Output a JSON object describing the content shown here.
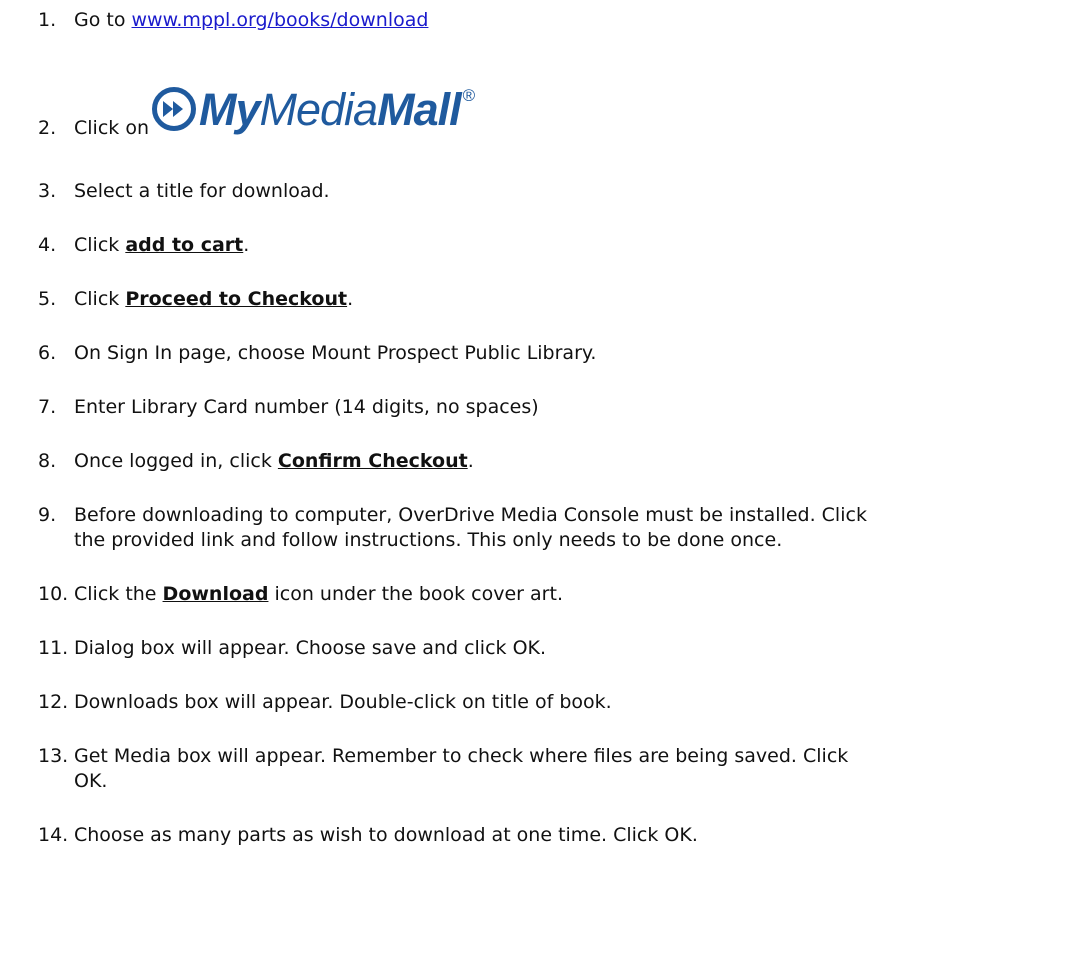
{
  "steps": [
    {
      "num": "1.",
      "pre": "Go to ",
      "link": "www.mppl.org/books/download"
    },
    {
      "num": "2.",
      "text": "Click on"
    },
    {
      "num": "3.",
      "text": "Select a title for download."
    },
    {
      "num": "4.",
      "pre": "Click ",
      "bold": "add to cart",
      "post": "."
    },
    {
      "num": "5.",
      "pre": "Click ",
      "bold": "Proceed to Checkout",
      "post": "."
    },
    {
      "num": "6.",
      "text": "On Sign In page, choose Mount Prospect Public Library."
    },
    {
      "num": "7.",
      "text": "Enter Library Card number (14 digits, no spaces)"
    },
    {
      "num": "8.",
      "pre": "Once logged in, click ",
      "bold": "Confirm Checkout",
      "post": "."
    },
    {
      "num": "9.",
      "line1": "Before downloading to computer, OverDrive Media Console must be installed.  Click",
      "line2": "the provided link and follow instructions.  This only needs to be done once."
    },
    {
      "num": "10.",
      "pre": " Click the ",
      "bold": "Download",
      "post": " icon under the book cover art."
    },
    {
      "num": "11.",
      "text": " Dialog box will appear.  Choose save and click OK."
    },
    {
      "num": "12.",
      "text": " Downloads box will appear.  Double-click on title of book."
    },
    {
      "num": "13.",
      "line1": " Get Media box will appear.  Remember to check where files are being saved.  Click",
      "line2": "OK."
    },
    {
      "num": "14.",
      "text": " Choose as many parts as wish to download at one time.  Click OK."
    }
  ],
  "logo": {
    "bold_part": "My",
    "light_part": "Media",
    "bold_part2": "Mall",
    "reg_mark": "®",
    "icon": "fast-forward-icon",
    "color": "#1f5a9e"
  },
  "colors": {
    "link": "#1a1acc",
    "text": "#111111"
  }
}
